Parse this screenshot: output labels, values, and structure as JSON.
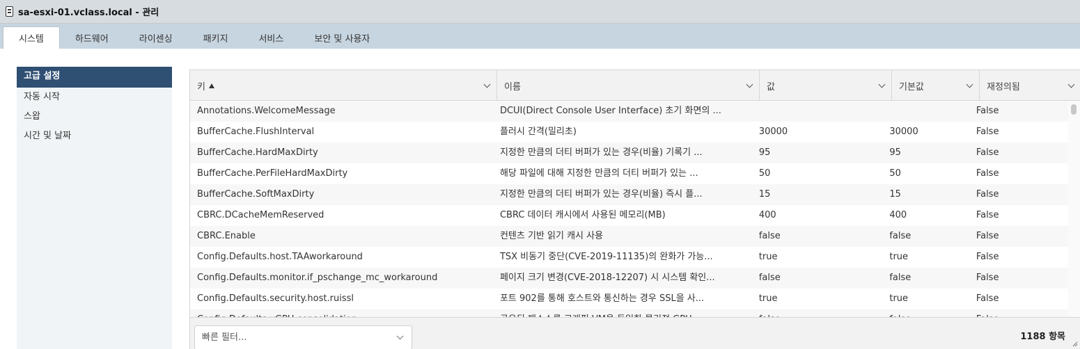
{
  "window": {
    "title": "sa-esxi-01.vclass.local - 관리",
    "icon": "host-icon"
  },
  "tabs": [
    {
      "label": "시스템",
      "active": true
    },
    {
      "label": "하드웨어",
      "active": false
    },
    {
      "label": "라이센싱",
      "active": false
    },
    {
      "label": "패키지",
      "active": false
    },
    {
      "label": "서비스",
      "active": false
    },
    {
      "label": "보안 및 사용자",
      "active": false
    }
  ],
  "sidebar": {
    "items": [
      {
        "label": "고급 설정",
        "active": true
      },
      {
        "label": "자동 시작",
        "active": false
      },
      {
        "label": "스왑",
        "active": false
      },
      {
        "label": "시간 및 날짜",
        "active": false
      }
    ]
  },
  "grid": {
    "columns": [
      {
        "label": "키",
        "sort": "ascending",
        "sort_icon": "sort-up-icon"
      },
      {
        "label": "이름"
      },
      {
        "label": "값"
      },
      {
        "label": "기본값"
      },
      {
        "label": "재정의됨"
      }
    ],
    "rows": [
      {
        "key": "Annotations.WelcomeMessage",
        "name": "DCUI(Direct Console User Interface) 초기 화면의 ...",
        "value": "",
        "default": "",
        "overridden": "False"
      },
      {
        "key": "BufferCache.FlushInterval",
        "name": "플러시 간격(밀리초)",
        "value": "30000",
        "default": "30000",
        "overridden": "False"
      },
      {
        "key": "BufferCache.HardMaxDirty",
        "name": "지정한 만큼의 더티 버퍼가 있는 경우(비율) 기록기 ...",
        "value": "95",
        "default": "95",
        "overridden": "False"
      },
      {
        "key": "BufferCache.PerFileHardMaxDirty",
        "name": "해당 파일에 대해 지정한 만큼의 더티 버퍼가 있는 ...",
        "value": "50",
        "default": "50",
        "overridden": "False"
      },
      {
        "key": "BufferCache.SoftMaxDirty",
        "name": "지정한 만큼의 더티 버퍼가 있는 경우(비율) 즉시 플...",
        "value": "15",
        "default": "15",
        "overridden": "False"
      },
      {
        "key": "CBRC.DCacheMemReserved",
        "name": "CBRC 데이터 캐시에서 사용된 메모리(MB)",
        "value": "400",
        "default": "400",
        "overridden": "False"
      },
      {
        "key": "CBRC.Enable",
        "name": "컨텐츠 기반 읽기 캐시 사용",
        "value": "false",
        "default": "false",
        "overridden": "False"
      },
      {
        "key": "Config.Defaults.host.TAAworkaround",
        "name": "TSX 비동기 중단(CVE-2019-11135)의 완화가 가능...",
        "value": "true",
        "default": "true",
        "overridden": "False"
      },
      {
        "key": "Config.Defaults.monitor.if_pschange_mc_workaround",
        "name": "페이지 크기 변경(CVE-2018-12207) 시 시스템 확인...",
        "value": "false",
        "default": "false",
        "overridden": "False"
      },
      {
        "key": "Config.Defaults.security.host.ruissl",
        "name": "포트 902를 통해 호스트와 통신하는 경우 SSL을 사...",
        "value": "true",
        "default": "true",
        "overridden": "False"
      },
      {
        "key": "Config.Defaults.vGPU.consolidation",
        "name": "공유된 패스스루 그래픽 VM을 동일한 물리적 GPU ...",
        "value": "false",
        "default": "false",
        "overridden": "False"
      }
    ]
  },
  "footer": {
    "filter_placeholder": "빠른 필터...",
    "count_text": "1188 항목"
  }
}
